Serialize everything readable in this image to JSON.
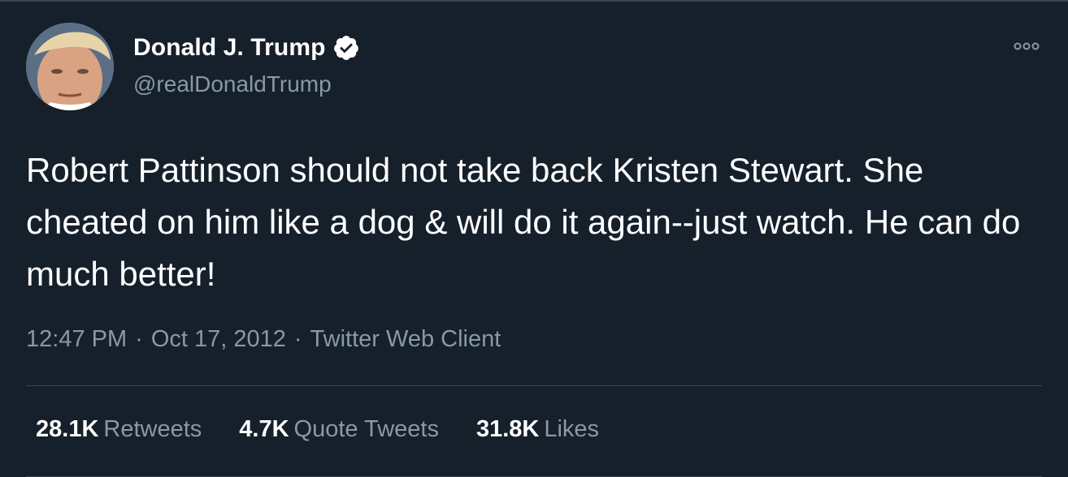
{
  "author": {
    "display_name": "Donald J. Trump",
    "handle": "@realDonaldTrump",
    "verified": true,
    "avatar_icon": "profile-photo",
    "verified_icon": "verified-badge-icon"
  },
  "tweet": {
    "text": "Robert Pattinson should not take back Kristen Stewart. She cheated on him like a dog & will do it again--just watch. He can do much better!"
  },
  "meta": {
    "time": "12:47 PM",
    "separator": "·",
    "date": "Oct 17, 2012",
    "source": "Twitter Web Client"
  },
  "stats": [
    {
      "count": "28.1K",
      "label": "Retweets"
    },
    {
      "count": "4.7K",
      "label": "Quote Tweets"
    },
    {
      "count": "31.8K",
      "label": "Likes"
    }
  ],
  "colors": {
    "background": "#15202b",
    "secondary_text": "#8899a6",
    "divider": "#38444d"
  }
}
